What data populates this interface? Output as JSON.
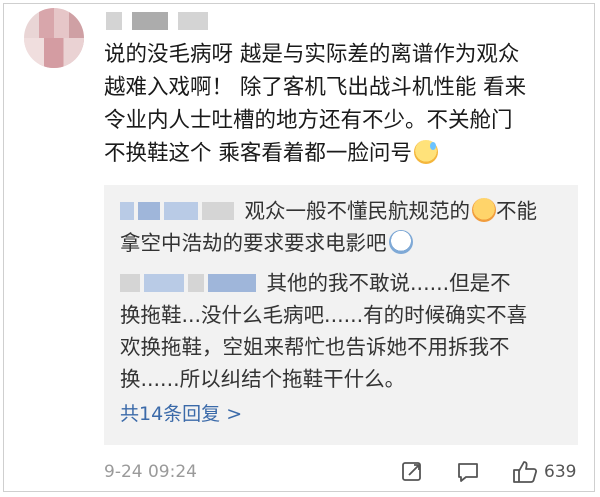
{
  "comment": {
    "lines": [
      "说的没毛病呀 越是与实际差的离谱作为观众",
      "越难入戏啊！ 除了客机飞出战斗机性能 看来",
      "令业内人士吐槽的地方还有不少。不关舱门",
      "不换鞋这个 乘客看着都一脸问号"
    ],
    "emoji_icon": "sweat-smile-icon"
  },
  "replies": [
    {
      "lines": [
        "观众一般不懂民航规范的",
        "不能",
        "拿空中浩劫的要求要求电影吧"
      ],
      "emoji_icons": [
        "tongue-emoji-icon",
        "shocked-emoji-icon"
      ]
    },
    {
      "lines": [
        "其他的我不敢说......但是不",
        "换拖鞋...没什么毛病吧......有的时候确实不喜",
        "欢换拖鞋，空姐来帮忙也告诉她不用拆我不",
        "换......所以纠结个拖鞋干什么。"
      ]
    }
  ],
  "more_replies_label": "共14条回复 >",
  "footer": {
    "timestamp": "9-24 09:24",
    "like_count": "639",
    "icons": [
      "share-icon",
      "comment-icon",
      "like-icon"
    ]
  },
  "colors": {
    "link": "#3b6aa9",
    "reply_bg": "#f2f2f2",
    "meta_text": "#9a9a9a"
  }
}
